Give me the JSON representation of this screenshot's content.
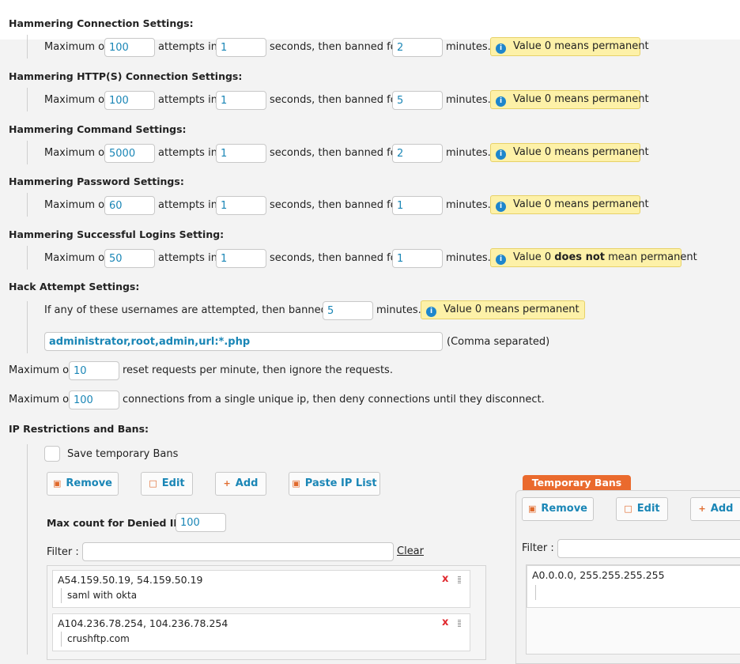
{
  "hammering": [
    {
      "title": "Hammering Connection Settings:",
      "max": "100",
      "secs": "1",
      "ban": "2",
      "info_pre": "Value 0 ",
      "info_bold": "",
      "info_post": "means permanent"
    },
    {
      "title": "Hammering HTTP(S) Connection Settings:",
      "max": "100",
      "secs": "1",
      "ban": "5",
      "info_pre": "Value 0 ",
      "info_bold": "",
      "info_post": "means permanent"
    },
    {
      "title": "Hammering Command Settings:",
      "max": "5000",
      "secs": "1",
      "ban": "2",
      "info_pre": "Value 0 ",
      "info_bold": "",
      "info_post": "means permanent"
    },
    {
      "title": "Hammering Password Settings:",
      "max": "60",
      "secs": "1",
      "ban": "1",
      "info_pre": "Value 0 ",
      "info_bold": "",
      "info_post": "means permanent"
    },
    {
      "title": "Hammering Successful Logins Setting:",
      "max": "50",
      "secs": "1",
      "ban": "1",
      "info_pre": "Value 0 ",
      "info_bold": "does not",
      "info_post": " mean permanent"
    }
  ],
  "labels": {
    "maximum_of": "Maximum of",
    "attempts_in": "attempts in",
    "seconds_banned": "seconds, then banned for",
    "minutes": "minutes."
  },
  "hack": {
    "title": "Hack Attempt Settings:",
    "text": "If any of these usernames are attempted, then banned for",
    "ban": "5",
    "minutes": "minutes.",
    "info": "Value 0 means permanent",
    "usernames": "administrator,root,admin,url:*.php",
    "comma_note": "(Comma separated)"
  },
  "reset": {
    "prefix": "Maximum of",
    "value": "10",
    "suffix": "reset requests per minute, then ignore the requests."
  },
  "conn": {
    "prefix": "Maximum of",
    "value": "100",
    "suffix": "connections from a single unique ip, then deny connections until they disconnect."
  },
  "ip": {
    "title": "IP Restrictions and Bans:",
    "save_temp": "Save temporary Bans",
    "buttons": {
      "remove": "Remove",
      "edit": "Edit",
      "add": "Add",
      "paste": "Paste IP List"
    },
    "max_denied_label": "Max count for Denied IPs:",
    "max_denied": "100",
    "filter_label": "Filter :",
    "filter_value": "",
    "clear": "Clear",
    "entries": [
      {
        "ip": "A54.159.50.19, 54.159.50.19",
        "note": "saml with okta"
      },
      {
        "ip": "A104.236.78.254, 104.236.78.254",
        "note": "crushftp.com"
      }
    ],
    "delete_symbol": "x"
  },
  "temp": {
    "tab": "Temporary Bans",
    "buttons": {
      "remove": "Remove",
      "edit": "Edit",
      "add": "Add"
    },
    "filter_label": "Filter :",
    "entries": [
      {
        "ip": "A0.0.0.0, 255.255.255.255",
        "note": ""
      }
    ]
  },
  "colors": {
    "accent": "#1a86b6",
    "orange": "#ea6a2d",
    "info_bg": "#fdf1a8",
    "delete": "#e0282e"
  }
}
